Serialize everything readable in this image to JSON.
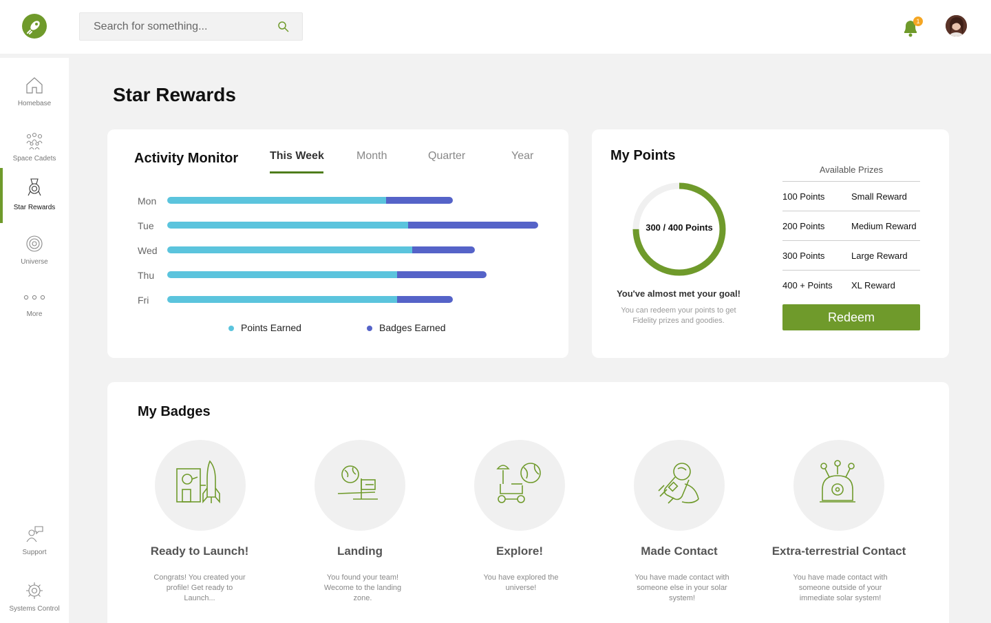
{
  "search": {
    "placeholder": "Search for something..."
  },
  "notifications": {
    "count": "1"
  },
  "sidebar": {
    "items": [
      {
        "label": "Homebase",
        "icon": "home-icon"
      },
      {
        "label": "Space Cadets",
        "icon": "people-icon"
      },
      {
        "label": "Star Rewards",
        "icon": "medal-icon",
        "active": true
      },
      {
        "label": "Universe",
        "icon": "target-icon"
      },
      {
        "label": "More",
        "icon": "more-icon"
      },
      {
        "label": "Support",
        "icon": "support-icon"
      },
      {
        "label": "Systems Control",
        "icon": "gear-icon"
      }
    ]
  },
  "page_title": "Star Rewards",
  "activity": {
    "title": "Activity Monitor",
    "tabs": [
      "This Week",
      "Month",
      "Quarter",
      "Year"
    ],
    "active_tab": "This Week",
    "legend": {
      "points": "Points Earned",
      "badges": "Badges Earned"
    },
    "colors": {
      "points": "#5bc4dd",
      "badges": "#5563c8"
    }
  },
  "chart_data": {
    "type": "bar",
    "orientation": "horizontal",
    "stacked": true,
    "categories": [
      "Mon",
      "Tue",
      "Wed",
      "Thu",
      "Fri"
    ],
    "series": [
      {
        "name": "Points Earned",
        "values": [
          59,
          65,
          66,
          62,
          62
        ]
      },
      {
        "name": "Badges Earned",
        "values": [
          18,
          35,
          17,
          24,
          15
        ]
      }
    ],
    "xlim": [
      0,
      100
    ],
    "legend_position": "bottom"
  },
  "points": {
    "title": "My Points",
    "current": 300,
    "goal": 400,
    "ring_label": "300 / 400 Points",
    "goal_title": "You've almost met your goal!",
    "goal_sub": "You can redeem your points to get Fidelity prizes and goodies.",
    "prizes_title": "Available Prizes",
    "prizes": [
      {
        "points": "100 Points",
        "reward": "Small Reward"
      },
      {
        "points": "200 Points",
        "reward": "Medium Reward"
      },
      {
        "points": "300 Points",
        "reward": "Large Reward"
      },
      {
        "points": "400 + Points",
        "reward": "XL Reward"
      }
    ],
    "redeem_label": "Redeem",
    "ring_color": "#6f9a2b"
  },
  "badges": {
    "title": "My Badges",
    "items": [
      {
        "title": "Ready to Launch!",
        "desc": "Congrats! You created your profile! Get ready to Launch...",
        "icon": "rocket-icon"
      },
      {
        "title": "Landing",
        "desc": "You found your team! Wecome to the landing zone.",
        "icon": "landing-flag-icon"
      },
      {
        "title": "Explore!",
        "desc": "You have explored the universe!",
        "icon": "rover-icon"
      },
      {
        "title": "Made Contact",
        "desc": "You have made contact with someone else in your solar system!",
        "icon": "astronaut-icon"
      },
      {
        "title": "Extra-terrestrial Contact",
        "desc": "You have made contact with someone outside of your immediate solar system!",
        "icon": "alien-icon"
      }
    ]
  }
}
